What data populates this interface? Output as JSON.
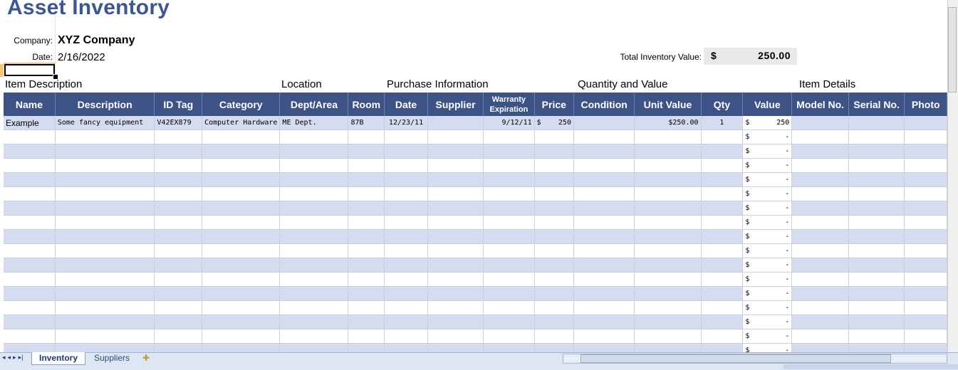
{
  "title": "Asset Inventory",
  "company_label": "Company:",
  "company": "XYZ Company",
  "date_label": "Date:",
  "date": "2/16/2022",
  "total_label": "Total Inventory Value:",
  "total_symbol": "$",
  "total_value": "250.00",
  "groups": {
    "item_description": "Item Description",
    "location": "Location",
    "purchase": "Purchase Information",
    "quantity": "Quantity and Value",
    "details": "Item Details"
  },
  "columns": [
    "Name",
    "Description",
    "ID Tag",
    "Category",
    "Dept/Area",
    "Room",
    "Date",
    "Supplier",
    "Warranty Expiration",
    "Price",
    "Condition",
    "Unit Value",
    "Qty",
    "Value",
    "Model No.",
    "Serial No.",
    "Photo"
  ],
  "example_row": {
    "name": "Example",
    "description": "Some fancy equipment",
    "id_tag": "V42EX879",
    "category": "Computer Hardware",
    "dept": "ME Dept.",
    "room": "87B",
    "date": "12/23/11",
    "supplier": "",
    "warranty": "9/12/11",
    "price_symbol": "$",
    "price": "250",
    "condition": "",
    "unit_value": "$250.00",
    "qty": "1",
    "value_symbol": "$",
    "value": "250"
  },
  "empty_value_symbol": "$",
  "empty_value_dash": "-",
  "sheet_tabs": [
    "Inventory",
    "Suppliers"
  ],
  "nav_icons": [
    "first-sheet-icon",
    "prev-sheet-icon",
    "next-sheet-icon",
    "last-sheet-icon"
  ]
}
